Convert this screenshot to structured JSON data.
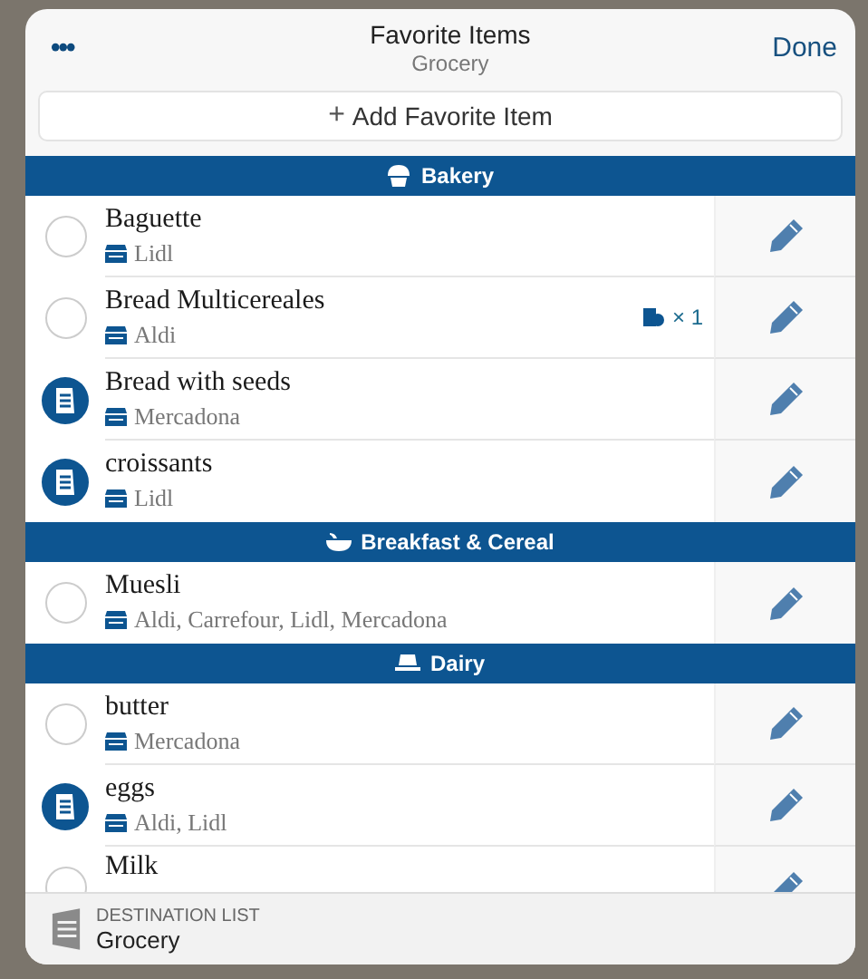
{
  "header": {
    "menu": "•••",
    "title": "Favorite Items",
    "subtitle": "Grocery",
    "done": "Done"
  },
  "add_button": {
    "icon": "+",
    "label": "Add Favorite Item"
  },
  "sections": [
    {
      "title": "Bakery",
      "kind": "bakery",
      "items": [
        {
          "name": "Baguette",
          "stores": "Lidl",
          "selected": false
        },
        {
          "name": "Bread Multicereales",
          "stores": "Aldi",
          "selected": false,
          "badge": "× 1"
        },
        {
          "name": "Bread with seeds",
          "stores": "Mercadona",
          "selected": true
        },
        {
          "name": "croissants",
          "stores": "Lidl",
          "selected": true
        }
      ]
    },
    {
      "title": "Breakfast & Cereal",
      "kind": "bowl",
      "items": [
        {
          "name": "Muesli",
          "stores": "Aldi, Carrefour, Lidl, Mercadona",
          "selected": false
        }
      ]
    },
    {
      "title": "Dairy",
      "kind": "dairy",
      "items": [
        {
          "name": "butter",
          "stores": "Mercadona",
          "selected": false
        },
        {
          "name": "eggs",
          "stores": "Aldi, Lidl",
          "selected": true
        },
        {
          "name": "Milk",
          "selected": false
        }
      ]
    }
  ],
  "footer": {
    "label": "DESTINATION LIST",
    "value": "Grocery"
  }
}
